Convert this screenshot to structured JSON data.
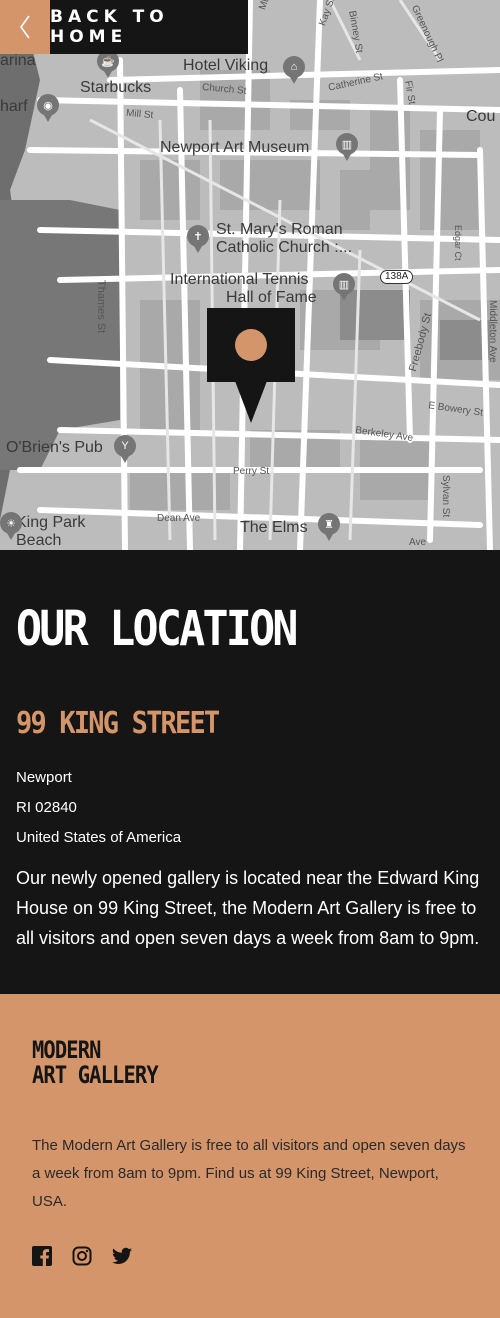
{
  "nav": {
    "back_label": "BACK TO HOME",
    "back_icon": "chevron-left-icon"
  },
  "map": {
    "labels": {
      "hotel_viking": "Hotel Viking",
      "starbucks": "Starbucks",
      "church_st": "Church St",
      "catherine_st": "Catherine St",
      "mill_st": "Mill St",
      "newport_art_museum": "Newport Art Museum",
      "st_marys_1": "St. Mary's Roman",
      "st_marys_2": "Catholic Church :...",
      "intl_tennis_1": "International Tennis",
      "intl_tennis_2": "Hall of Fame",
      "thames_st": "Thames St",
      "route_138a": "138A",
      "freebody_st": "Freebody St",
      "e_bowery_st": "E Bowery St",
      "berkeley_ave": "Berkeley Ave",
      "obriens_pub": "O'Brien's Pub",
      "perry_st": "Perry St",
      "dean_ave": "Dean Ave",
      "the_elms": "The Elms",
      "king_park_1": "King Park",
      "king_park_2": "Beach",
      "sylvan_st": "Sylvan St",
      "middleton_ave": "Middleton Ave",
      "edgar_ct": "Edgar Ct",
      "fir_st": "Fir St",
      "binney_st": "Binney St",
      "greenough_pl": "Greenough Pl",
      "kay_st": "Kay St",
      "mt_partial": "Mt",
      "cou_partial": "Cou",
      "arina_partial": "arina",
      "harf_partial": "harf",
      "ave_partial": "Ave",
      "st_partial": "St"
    }
  },
  "location": {
    "title": "OUR LOCATION",
    "street": "99 KING STREET",
    "city": "Newport",
    "state_zip": "RI 02840",
    "country": "United States of America",
    "description": "Our newly opened gallery is located near the Edward King House on 99 King Street, the Modern Art Gallery is free to all visitors and open seven days a week from 8am to 9pm."
  },
  "footer": {
    "logo_line1": "MODERN",
    "logo_line2": "ART GALLERY",
    "about": "The Modern Art Gallery is free to all visitors and open seven days a week from 8am to 9pm. Find us at 99 King Street, Newport, USA.",
    "social": [
      "facebook-icon",
      "instagram-icon",
      "twitter-icon"
    ]
  },
  "colors": {
    "accent": "#d5956b",
    "dark": "#151515",
    "map_bg": "#bdbdbd"
  }
}
